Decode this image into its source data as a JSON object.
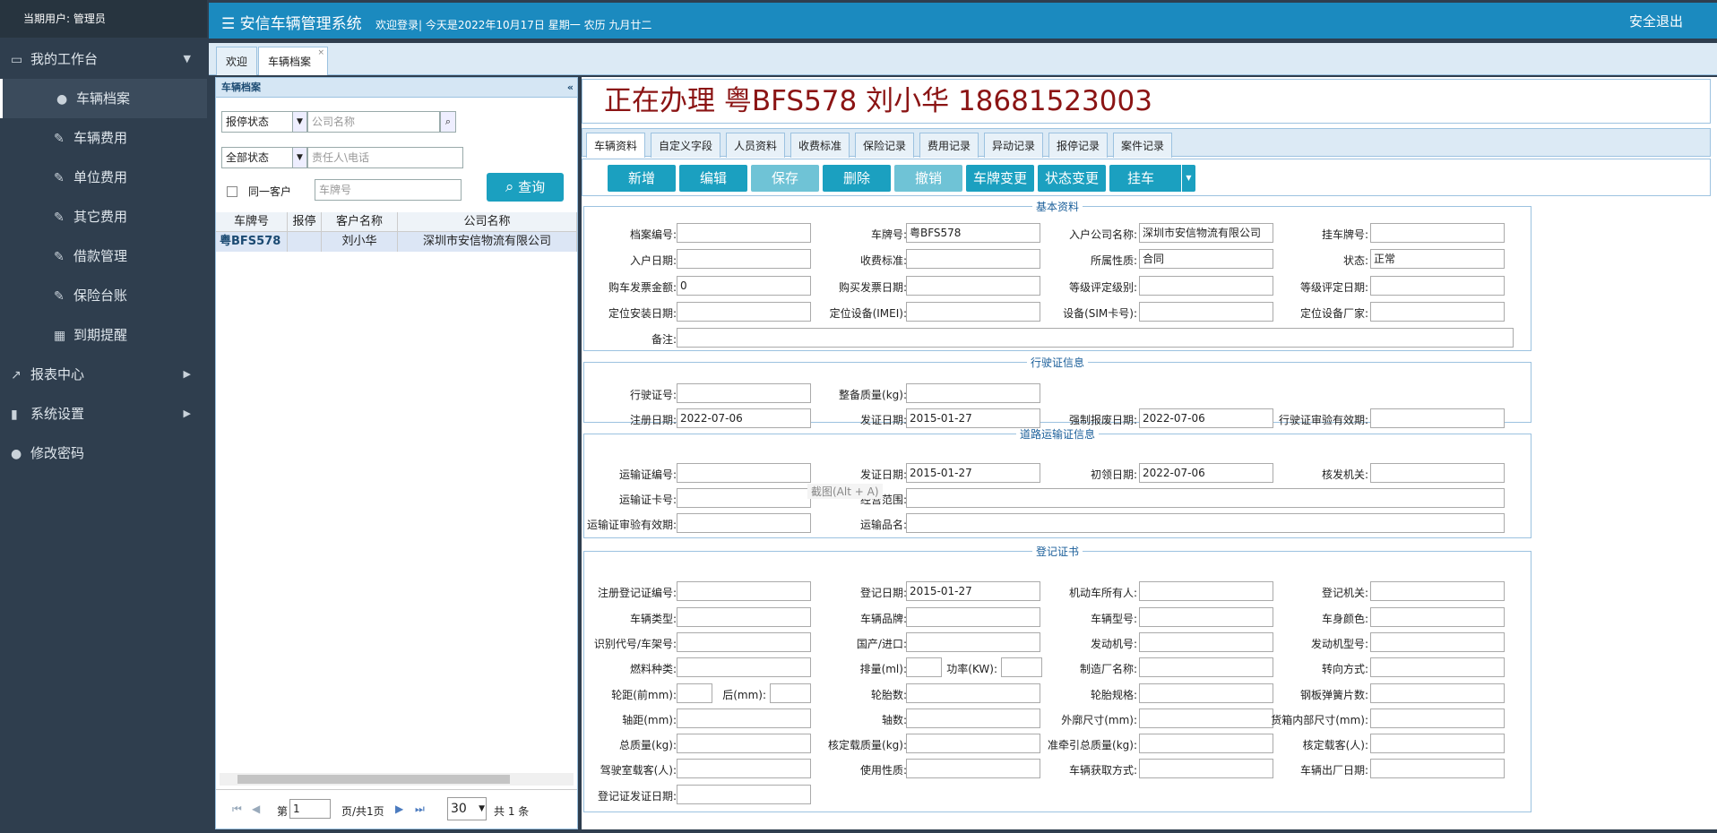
{
  "user_label": "当期用户: 管理员",
  "nav": {
    "workbench": "我的工作台",
    "items": [
      "车辆档案",
      "车辆费用",
      "单位费用",
      "其它费用",
      "借款管理",
      "保险台账",
      "到期提醒"
    ],
    "reports": "报表中心",
    "settings": "系统设置",
    "password": "修改密码"
  },
  "header": {
    "title": "安信车辆管理系统",
    "welcome": "欢迎登录| 今天是2022年10月17日 星期一 农历 九月廿二",
    "logout": "安全退出"
  },
  "tabs": [
    "欢迎",
    "车辆档案"
  ],
  "left": {
    "panel_title": "车辆档案",
    "status1": "报停状态",
    "company_ph": "公司名称",
    "status2": "全部状态",
    "person_ph": "责任人\\电话",
    "same_customer": "同一客户",
    "plate_ph": "车牌号",
    "query": "查询",
    "cols": [
      "车牌号",
      "报停",
      "客户名称",
      "公司名称"
    ],
    "row": [
      "粤BFS578",
      "",
      "刘小华",
      "深圳市安信物流有限公司"
    ],
    "pager": {
      "page_prefix": "第",
      "page": "1",
      "page_suffix": "页/共1页",
      "size": "30",
      "total": "共 1 条"
    }
  },
  "title": "正在办理 粤BFS578 刘小华 18681523003",
  "subtabs": [
    "车辆资料",
    "自定义字段",
    "人员资料",
    "收费标准",
    "保险记录",
    "费用记录",
    "异动记录",
    "报停记录",
    "案件记录"
  ],
  "toolbar": [
    "新增",
    "编辑",
    "保存",
    "删除",
    "撤销",
    "车牌变更",
    "状态变更",
    "挂车"
  ],
  "sections": {
    "basic": "基本资料",
    "license": "行驶证信息",
    "transport": "道路运输证信息",
    "registration": "登记证书"
  },
  "basic": {
    "labels": [
      "档案编号:",
      "车牌号:",
      "入户公司名称:",
      "挂车牌号:",
      "入户日期:",
      "收费标准:",
      "所属性质:",
      "状态:",
      "购车发票金额:",
      "购买发票日期:",
      "等级评定级别:",
      "等级评定日期:",
      "定位安装日期:",
      "定位设备(IMEI):",
      "设备(SIM卡号):",
      "定位设备厂家:",
      "备注:"
    ],
    "values": [
      "",
      "粤BFS578",
      "深圳市安信物流有限公司",
      "",
      "",
      "",
      "合同",
      "正常",
      "0",
      "",
      "",
      "",
      "",
      "",
      "",
      ""
    ]
  },
  "license": {
    "labels": [
      "行驶证号:",
      "整备质量(kg):",
      "注册日期:",
      "发证日期:",
      "强制报废日期:",
      "行驶证审验有效期:"
    ],
    "values": [
      "",
      "",
      "2022-07-06",
      "2015-01-27",
      "2022-07-06",
      ""
    ]
  },
  "transport": {
    "labels": [
      "运输证编号:",
      "发证日期:",
      "初领日期:",
      "核发机关:",
      "运输证卡号:",
      "经营范围:",
      "运输证审验有效期:",
      "运输品名:"
    ],
    "values": [
      "",
      "2015-01-27",
      "2022-07-06",
      "",
      "",
      "",
      "",
      ""
    ],
    "tooltip": "截图(Alt + A)"
  },
  "registration": {
    "labels": [
      "注册登记证编号:",
      "登记日期:",
      "机动车所有人:",
      "登记机关:",
      "车辆类型:",
      "车辆品牌:",
      "车辆型号:",
      "车身颜色:",
      "识别代号/车架号:",
      "国产/进口:",
      "发动机号:",
      "发动机型号:",
      "燃料种类:",
      "排量(ml):",
      "功率(KW):",
      "制造厂名称:",
      "转向方式:",
      "轮距(前mm):",
      "后(mm):",
      "轮胎数:",
      "轮胎规格:",
      "钢板弹簧片数:",
      "轴距(mm):",
      "轴数:",
      "外廓尺寸(mm):",
      "货箱内部尺寸(mm):",
      "总质量(kg):",
      "核定载质量(kg):",
      "准牵引总质量(kg):",
      "核定载客(人):",
      "驾驶室载客(人):",
      "使用性质:",
      "车辆获取方式:",
      "车辆出厂日期:",
      "登记证发证日期:"
    ],
    "reg_date": "2015-01-27"
  }
}
